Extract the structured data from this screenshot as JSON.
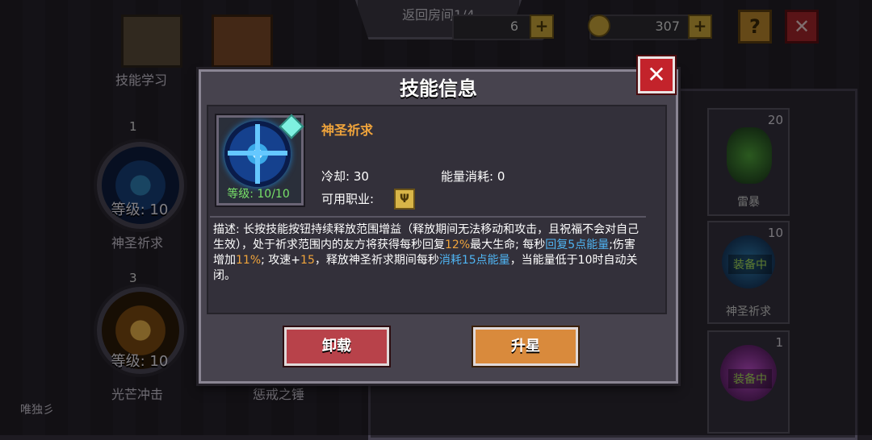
{
  "top": {
    "room_tab": "返回房间1/4",
    "currency_1_value": "6",
    "currency_2_value": "307",
    "help_label": "?",
    "close_label": "✕"
  },
  "left": {
    "skill_learn_label": "技能学习",
    "medals": [
      {
        "badge": "1",
        "level": "等级: 10",
        "name": "神圣祈求"
      },
      {
        "badge": "3",
        "level": "等级: 10",
        "name": "光芒冲击"
      }
    ],
    "third_label": "惩戒之锤",
    "corner_label": "唯独彡"
  },
  "right_cards": [
    {
      "count": "20",
      "name": "雷暴"
    },
    {
      "count": "10",
      "name": "神圣祈求",
      "badge": "装备中"
    },
    {
      "count": "1",
      "badge": "装备中"
    }
  ],
  "dialog": {
    "title": "技能信息",
    "close_label": "✕",
    "skill_name": "神圣祈求",
    "icon_level": "等级: 10/10",
    "cooldown": "冷却: 30",
    "energy_cost": "能量消耗: 0",
    "class_label": "可用职业:",
    "desc_parts": [
      {
        "t": "描述: 长按技能按钮持续释放范围增益（释放期间无法移动和攻击，且祝福不会对自己生效），处于祈求范围内的友方将获得每秒回复",
        "c": ""
      },
      {
        "t": "12%",
        "c": "orange"
      },
      {
        "t": "最大生命; 每秒",
        "c": ""
      },
      {
        "t": "回复5点能量",
        "c": "blue"
      },
      {
        "t": ";伤害增加",
        "c": ""
      },
      {
        "t": "11%",
        "c": "orange"
      },
      {
        "t": "; 攻速+",
        "c": ""
      },
      {
        "t": "15",
        "c": "orange"
      },
      {
        "t": "，释放神圣祈求期间每秒",
        "c": ""
      },
      {
        "t": "消耗15点能量",
        "c": "blue"
      },
      {
        "t": "，当能量低于10时自动关闭。",
        "c": ""
      }
    ],
    "unload_label": "卸载",
    "upgrade_label": "升星"
  },
  "colors": {
    "accent_orange": "#f0a43b",
    "accent_blue": "#4fb4f2",
    "level_green": "#78e26a"
  }
}
